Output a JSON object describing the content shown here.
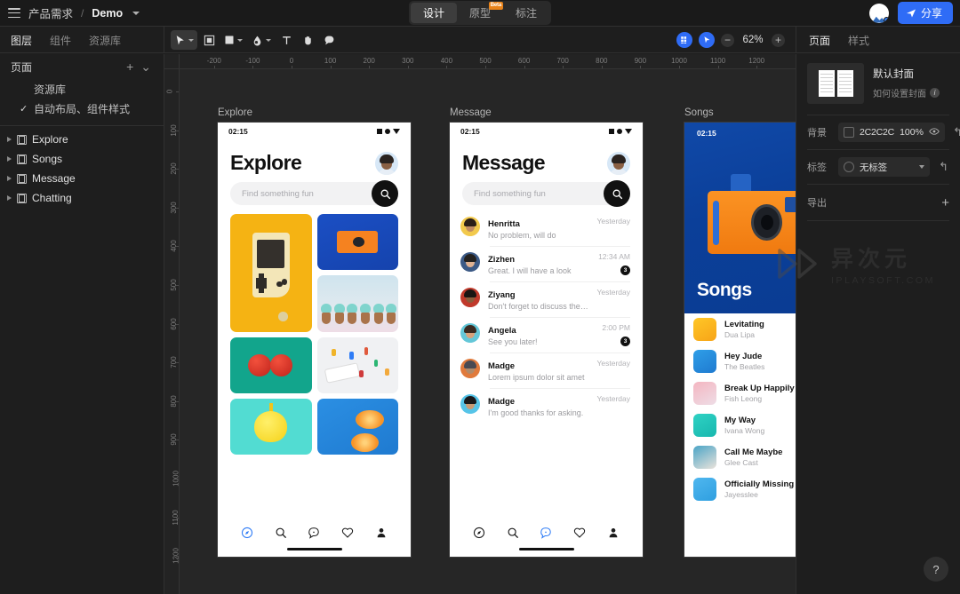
{
  "topbar": {
    "menu_icon": "hamburger-icon",
    "breadcrumb_root": "产品需求",
    "breadcrumb_sep": "/",
    "breadcrumb_current": "Demo",
    "tabs": [
      {
        "label": "设计",
        "active": true,
        "badge": ""
      },
      {
        "label": "原型",
        "active": false,
        "badge": "Beta"
      },
      {
        "label": "标注",
        "active": false,
        "badge": ""
      }
    ],
    "share_label": "分享",
    "share_icon": "send-icon",
    "avatar": "user-avatar"
  },
  "left_tabs": [
    {
      "label": "图层",
      "active": true
    },
    {
      "label": "组件",
      "active": false
    },
    {
      "label": "资源库",
      "active": false
    }
  ],
  "toolbar": [
    {
      "name": "cursor-tool",
      "icon": "cursor-icon",
      "caret": true,
      "active": true
    },
    {
      "name": "frame-tool",
      "icon": "frame-icon",
      "caret": false,
      "active": false
    },
    {
      "name": "shape-tool",
      "icon": "square-icon",
      "caret": true,
      "active": false
    },
    {
      "name": "pen-tool",
      "icon": "pen-icon",
      "caret": true,
      "active": false
    },
    {
      "name": "text-tool",
      "icon": "text-icon",
      "caret": false,
      "active": false
    },
    {
      "name": "hand-tool",
      "icon": "hand-icon",
      "caret": false,
      "active": false
    },
    {
      "name": "comment-tool",
      "icon": "comment-icon",
      "caret": false,
      "active": false
    }
  ],
  "zoom": {
    "grid_icon": "grid-icon",
    "play_icon": "play-icon",
    "minus": "−",
    "value": "62%",
    "plus": "+"
  },
  "right_tabs": [
    {
      "label": "页面",
      "active": true
    },
    {
      "label": "样式",
      "active": false
    }
  ],
  "pages_panel": {
    "title": "页面",
    "add_icon": "plus-icon",
    "collapse_icon": "chevron-down-icon",
    "items": [
      {
        "label": "资源库",
        "checked": false
      },
      {
        "label": "自动布局、组件样式",
        "checked": true
      }
    ]
  },
  "layers": [
    {
      "label": "Explore"
    },
    {
      "label": "Songs"
    },
    {
      "label": "Message"
    },
    {
      "label": "Chatting"
    }
  ],
  "rulers": {
    "horizontal": [
      "-200",
      "-100",
      "0",
      "100",
      "200",
      "300",
      "400",
      "500",
      "600",
      "700",
      "800",
      "900",
      "1000",
      "1100",
      "1200"
    ],
    "vertical": [
      "0",
      "100",
      "200",
      "300",
      "400",
      "500",
      "600",
      "700",
      "800",
      "900",
      "1000",
      "1100",
      "1200"
    ]
  },
  "frames": [
    {
      "label": "Explore"
    },
    {
      "label": "Message"
    },
    {
      "label": "Songs"
    }
  ],
  "explore_screen": {
    "time": "02:15",
    "title": "Explore",
    "search_placeholder": "Find something fun",
    "search_icon": "search-icon",
    "tiles": [
      {
        "name": "gameboy-photo"
      },
      {
        "name": "orange-camera-photo"
      },
      {
        "name": "cupcakes-photo"
      },
      {
        "name": "tomatoes-photo"
      },
      {
        "name": "lego-desk-photo"
      },
      {
        "name": "lemon-photo"
      },
      {
        "name": "orange-slices-photo"
      }
    ],
    "nav": [
      {
        "name": "compass-icon",
        "active": true
      },
      {
        "name": "search-icon",
        "active": false
      },
      {
        "name": "message-icon",
        "active": false
      },
      {
        "name": "heart-icon",
        "active": false
      },
      {
        "name": "profile-icon",
        "active": false
      }
    ]
  },
  "message_screen": {
    "time": "02:15",
    "title": "Message",
    "search_placeholder": "Find something fun",
    "search_icon": "search-icon",
    "conversations": [
      {
        "name": "Henritta",
        "preview": "No problem, will do",
        "time": "Yesterday",
        "badge": "",
        "hair": "#2b1e17",
        "skin": "#c08b62",
        "body": "#f2c94c"
      },
      {
        "name": "Zizhen",
        "preview": "Great. I will have a look",
        "time": "12:34 AM",
        "badge": "3",
        "hair": "#23211f",
        "skin": "#e0b292",
        "body": "#3c5a86"
      },
      {
        "name": "Ziyang",
        "preview": "Don't forget to discuss the new...",
        "time": "Yesterday",
        "badge": "",
        "hair": "#191513",
        "skin": "#8a5c3c",
        "body": "#c0392b"
      },
      {
        "name": "Angela",
        "preview": "See you later!",
        "time": "2:00 PM",
        "badge": "3",
        "hair": "#3a2b21",
        "skin": "#d8a17a",
        "body": "#64c7d8"
      },
      {
        "name": "Madge",
        "preview": "Lorem ipsum dolor sit amet",
        "time": "Yesterday",
        "badge": "",
        "hair": "#4a4a52",
        "skin": "#b08a6a",
        "body": "#e07a3c"
      },
      {
        "name": "Madge",
        "preview": "I'm good thanks for asking.",
        "time": "Yesterday",
        "badge": "",
        "hair": "#1a1a1c",
        "skin": "#c99a74",
        "body": "#56c4e8"
      }
    ],
    "nav": [
      {
        "name": "compass-icon",
        "active": false
      },
      {
        "name": "search-icon",
        "active": false
      },
      {
        "name": "message-icon",
        "active": true
      },
      {
        "name": "heart-icon",
        "active": false
      },
      {
        "name": "profile-icon",
        "active": false
      }
    ]
  },
  "songs_screen": {
    "time": "02:15",
    "title": "Songs",
    "hero_image": "orange-camera-on-blue",
    "songs": [
      {
        "name": "Levitating",
        "artist": "Dua Lipa",
        "color1": "#ffc727",
        "color2": "#f7a418"
      },
      {
        "name": "Hey Jude",
        "artist": "The Beatles",
        "color1": "#2f9fe8",
        "color2": "#1f7ad0"
      },
      {
        "name": "Break Up Happily",
        "artist": "Fish Leong",
        "color1": "#f4b5c0",
        "color2": "#eedde6"
      },
      {
        "name": "My Way",
        "artist": "Ivana Wong",
        "color1": "#2fd2c4",
        "color2": "#18b7ae"
      },
      {
        "name": "Call Me Maybe",
        "artist": "Glee Cast",
        "color1": "#4aa4c6",
        "color2": "#eae3db"
      },
      {
        "name": "Officially Missing You",
        "artist": "Jayesslee",
        "color1": "#4fb7ef",
        "color2": "#2f9fe0"
      }
    ]
  },
  "right_panel": {
    "cover_title": "默认封面",
    "cover_help": "如何设置封面",
    "cover_info_icon": "info-icon",
    "background": {
      "label": "背景",
      "color": "2C2C2C",
      "color_display": "2C2C2C",
      "opacity": "100%",
      "eye_icon": "eye-icon",
      "revert_icon": "revert-icon"
    },
    "tag": {
      "label": "标签",
      "value": "无标签",
      "chevron_icon": "chevron-down-icon",
      "revert_icon": "revert-icon"
    },
    "export": {
      "label": "导出",
      "add_icon": "plus-icon"
    }
  },
  "watermark": {
    "cn": "异次元",
    "en": "IPLAYSOFT.COM"
  },
  "help_button": {
    "label": "?"
  }
}
